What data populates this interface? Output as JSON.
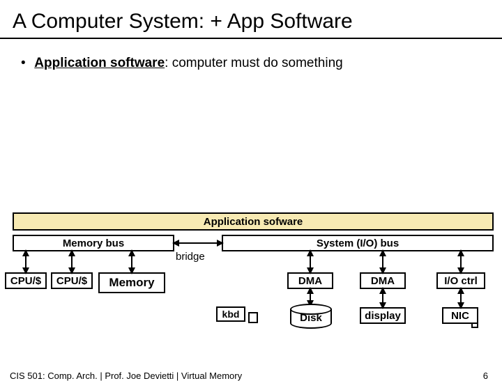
{
  "title": "A Computer System: + App Software",
  "bullet_prefix_bold": "Application software",
  "bullet_rest": ": computer must do something",
  "diagram": {
    "app_bar": "Application sofware",
    "mem_bus": "Memory bus",
    "sys_bus": "System (I/O) bus",
    "bridge": "bridge",
    "cpu1": "CPU/$",
    "cpu2": "CPU/$",
    "memory": "Memory",
    "dma1": "DMA",
    "dma2": "DMA",
    "ioctrl": "I/O ctrl",
    "kbd": "kbd",
    "disk": "Disk",
    "display": "display",
    "nic": "NIC"
  },
  "footer": {
    "source": "CIS 501: Comp. Arch.  |  Prof. Joe Devietti  |  Virtual Memory",
    "page": "6"
  }
}
